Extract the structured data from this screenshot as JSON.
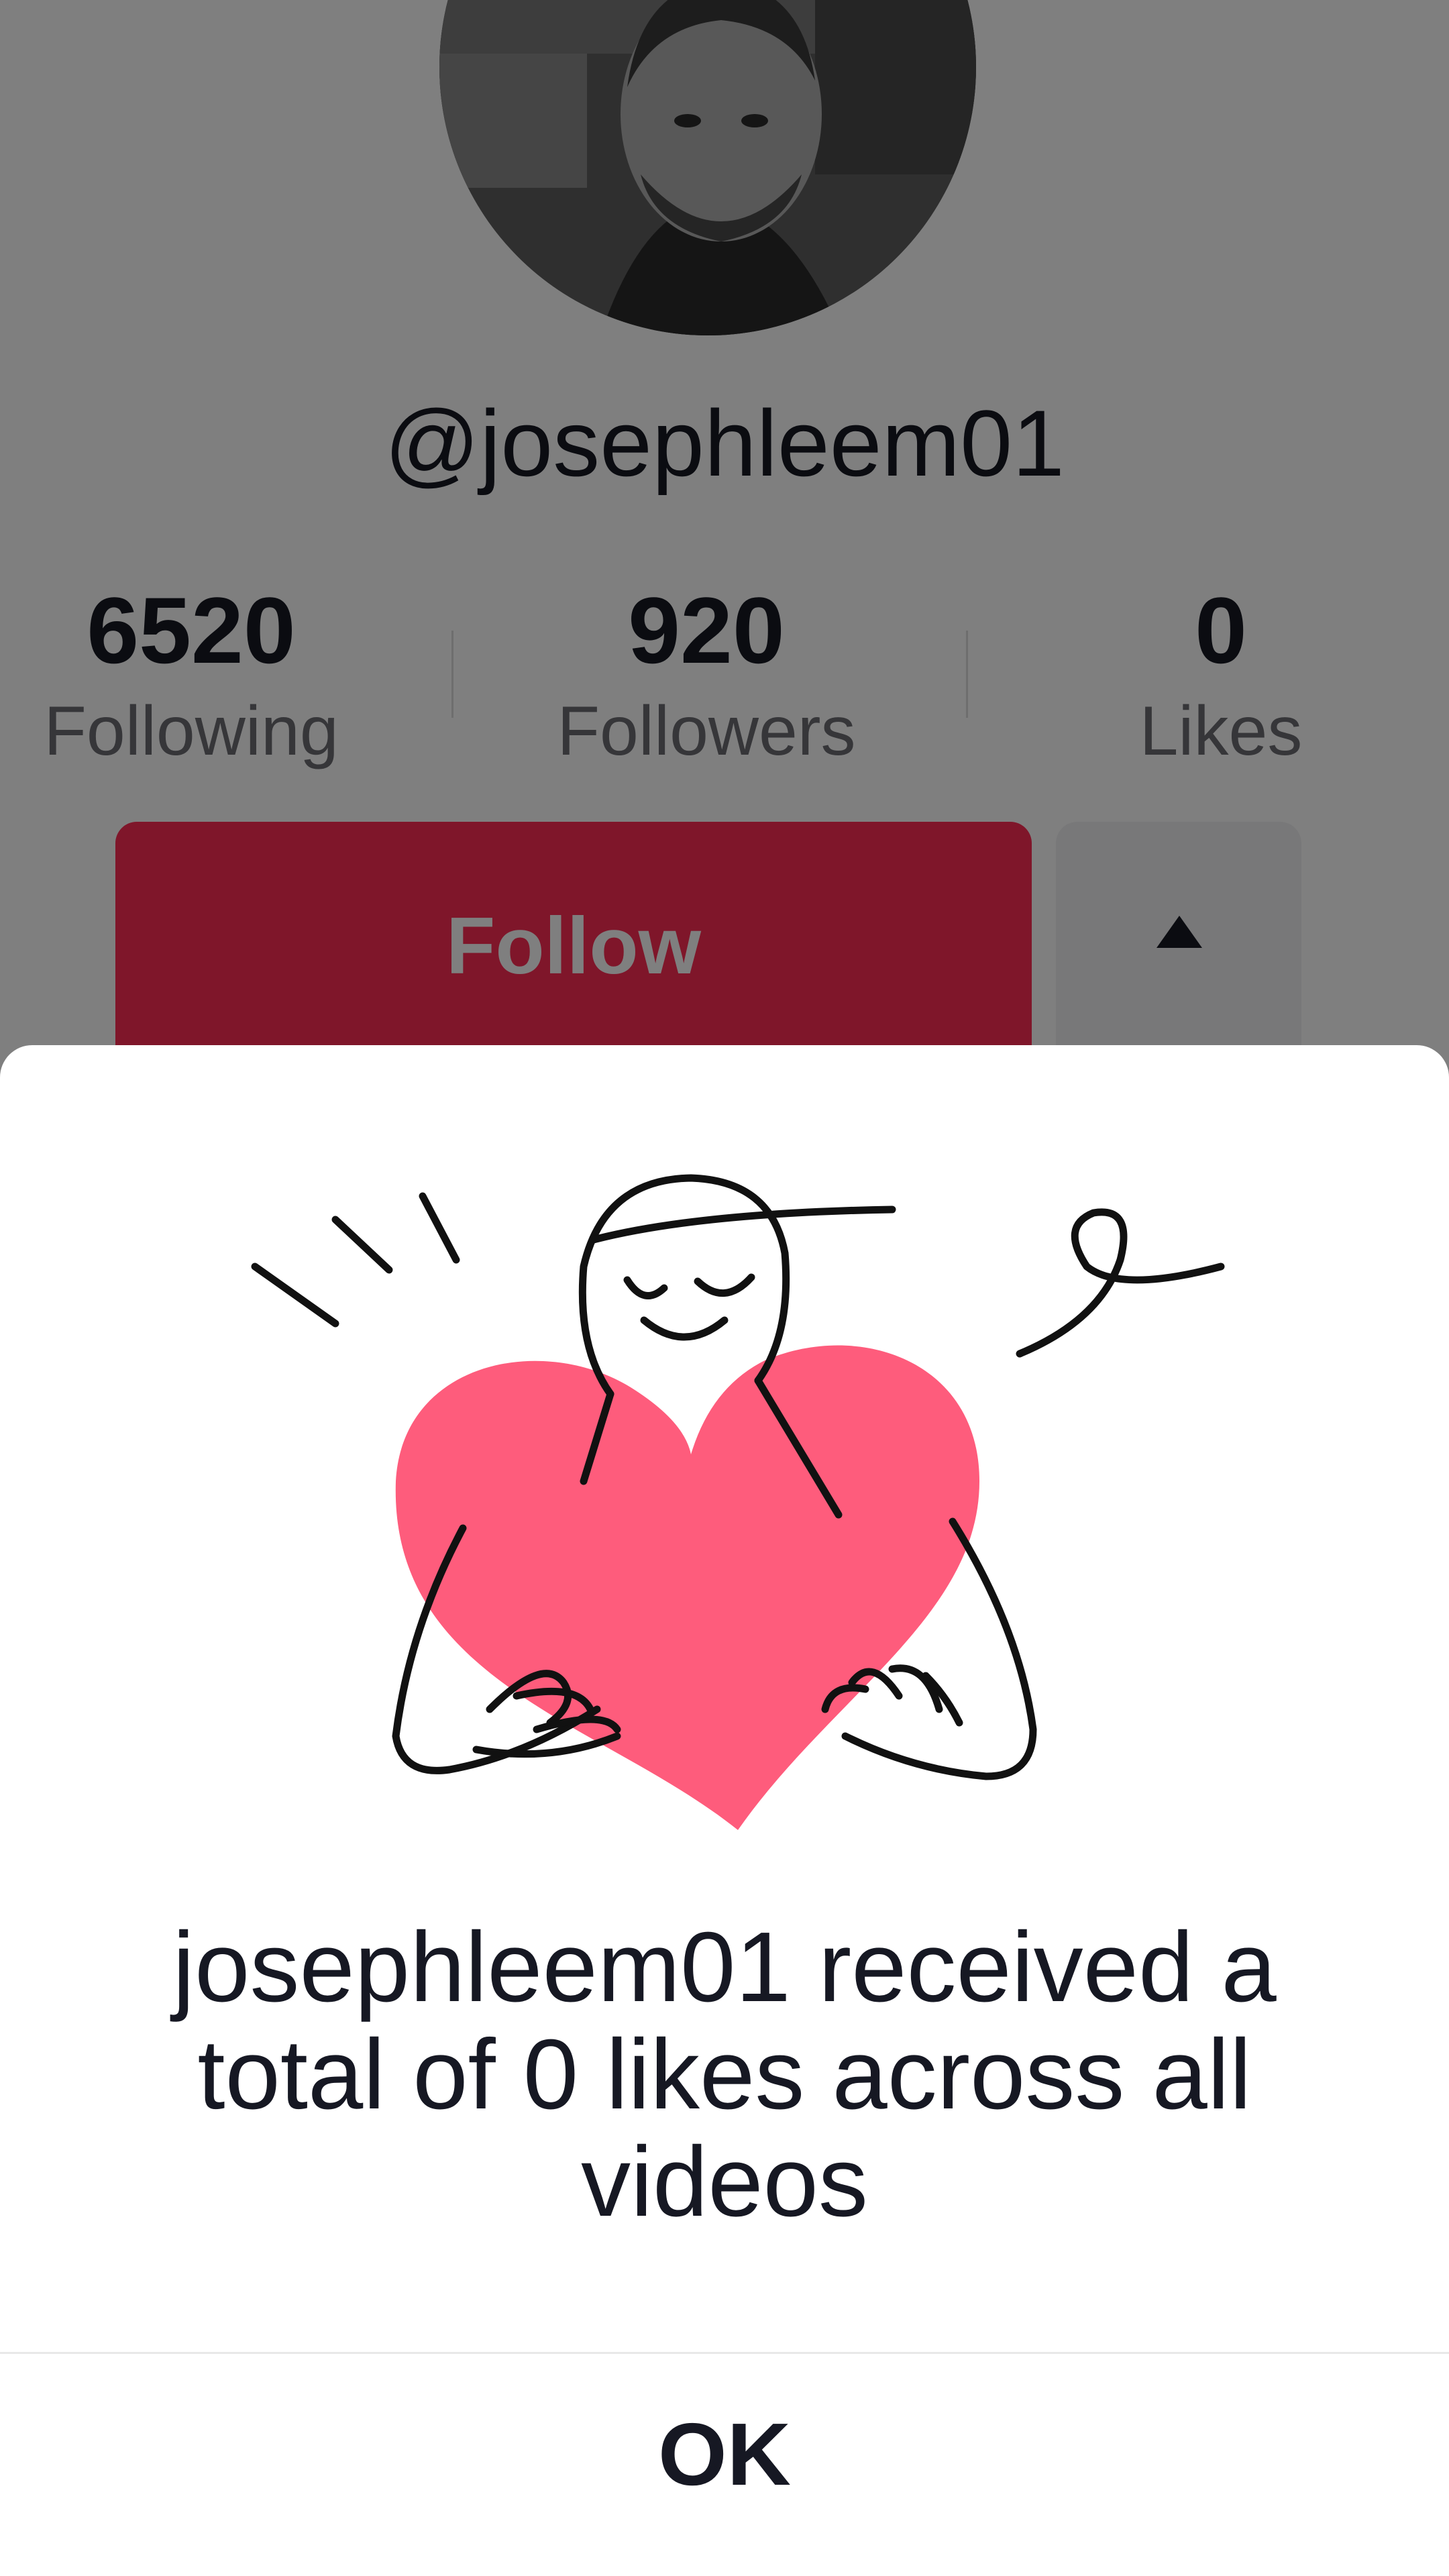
{
  "profile": {
    "username": "@josephleem01",
    "stats": [
      {
        "value": "6520",
        "label": "Following"
      },
      {
        "value": "920",
        "label": "Followers"
      },
      {
        "value": "0",
        "label": "Likes"
      }
    ],
    "follow_label": "Follow"
  },
  "dialog": {
    "message": "josephleem01 received a total of 0 likes across all videos",
    "ok_label": "OK"
  },
  "colors": {
    "accent": "#fe2c55",
    "heart": "#fe5c7c",
    "text": "#161823"
  },
  "icons": {
    "more": "triangle-up-icon",
    "illustration": "heart-hug-illustration"
  }
}
